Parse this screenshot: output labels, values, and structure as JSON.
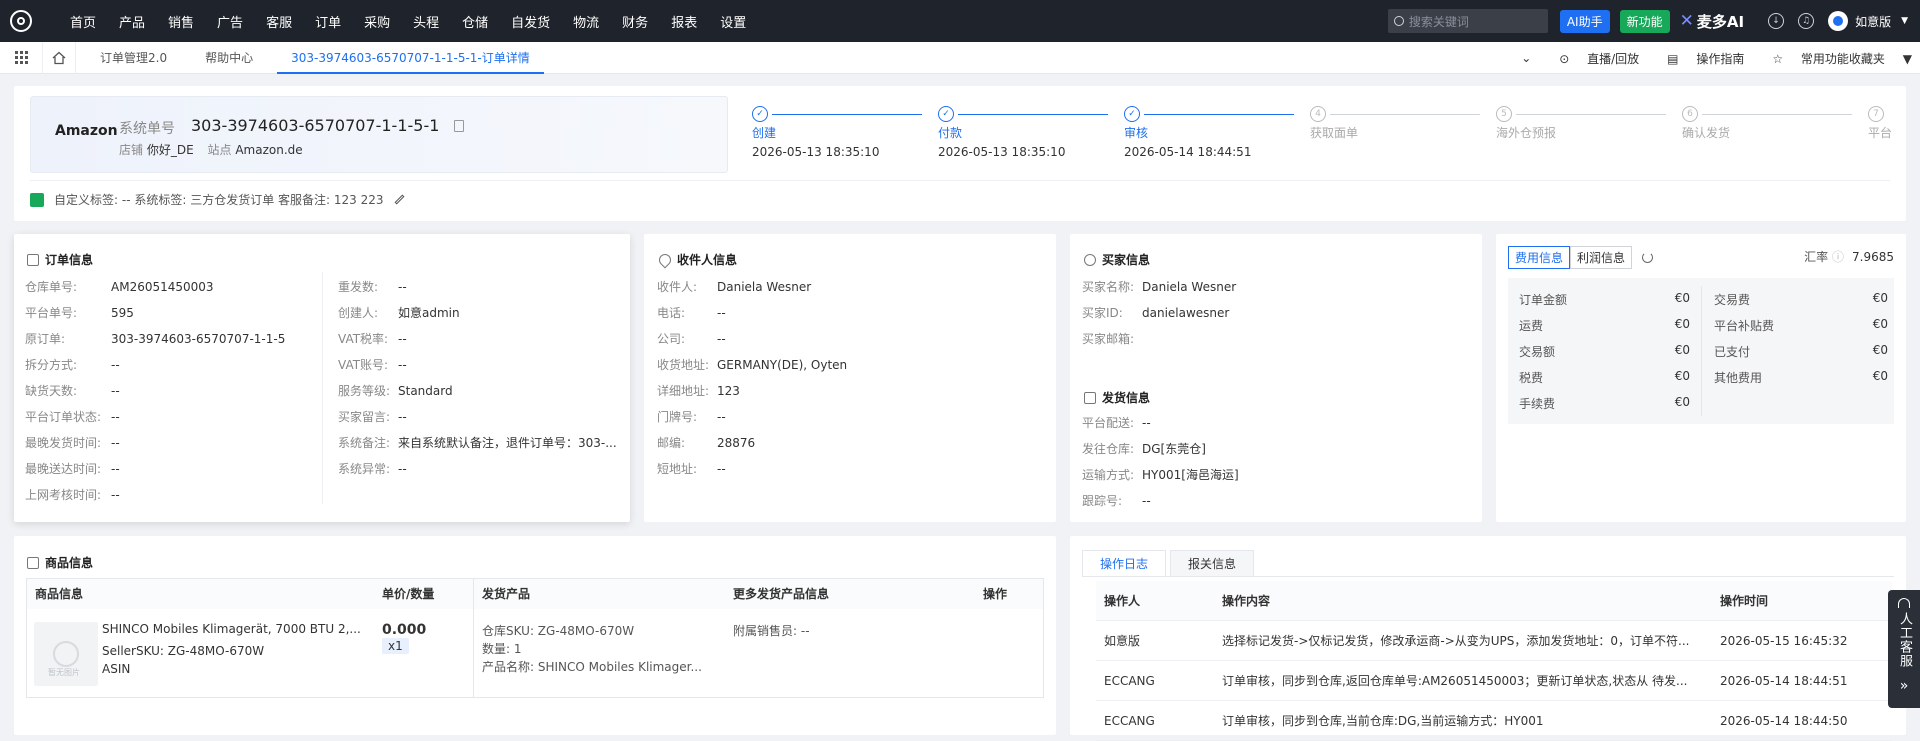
{
  "topbar": {
    "nav": [
      "首页",
      "产品",
      "销售",
      "广告",
      "客服",
      "订单",
      "采购",
      "头程",
      "仓储",
      "自发货",
      "物流",
      "财务",
      "报表",
      "设置"
    ],
    "search_placeholder": "搜索关键词",
    "ai_button": "AI助手",
    "new_button": "新功能",
    "brand": "麦多AI",
    "username": "如意版"
  },
  "tabbar": {
    "tabs": [
      "订单管理2.0",
      "帮助中心",
      "303-3974603-6570707-1-1-5-1-订单详情"
    ],
    "live": "直播/回放",
    "guide": "操作指南",
    "favorites": "常用功能收藏夹"
  },
  "order_header": {
    "platform": "Amazon",
    "sysno_label": "系统单号",
    "sysno": "303-3974603-6570707-1-1-5-1",
    "shop_label": "店铺",
    "shop": "你好_DE",
    "site_label": "站点",
    "site": "Amazon.de",
    "tags_line": "自定义标签: -- 系统标签: 三方仓发货订单 客服备注: 123 223"
  },
  "steps": [
    {
      "num": "✓",
      "label": "创建",
      "time": "2026-05-13 18:35:10",
      "done": true
    },
    {
      "num": "✓",
      "label": "付款",
      "time": "2026-05-13 18:35:10",
      "done": true
    },
    {
      "num": "✓",
      "label": "审核",
      "time": "2026-05-14 18:44:51",
      "done": true
    },
    {
      "num": "4",
      "label": "获取面单",
      "time": "",
      "done": false
    },
    {
      "num": "5",
      "label": "海外仓预报",
      "time": "",
      "done": false
    },
    {
      "num": "6",
      "label": "确认发货",
      "time": "",
      "done": false
    },
    {
      "num": "7",
      "label": "平台",
      "time": "",
      "done": false
    }
  ],
  "order_info": {
    "title": "订单信息",
    "left": [
      [
        "仓库单号:",
        "AM26051450003"
      ],
      [
        "平台单号:",
        "595"
      ],
      [
        "原订单:",
        "303-3974603-6570707-1-1-5"
      ],
      [
        "拆分方式:",
        "--"
      ],
      [
        "缺货天数:",
        "--"
      ],
      [
        "平台订单状态:",
        "--"
      ],
      [
        "最晚发货时间:",
        "--"
      ],
      [
        "最晚送达时间:",
        "--"
      ],
      [
        "上网考核时间:",
        "--"
      ]
    ],
    "right": [
      [
        "重发数:",
        "--"
      ],
      [
        "创建人:",
        "如意admin"
      ],
      [
        "VAT税率:",
        "--"
      ],
      [
        "VAT账号:",
        "--"
      ],
      [
        "服务等级:",
        "Standard"
      ],
      [
        "买家留言:",
        "--"
      ],
      [
        "系统备注:",
        "来自系统默认备注，退件订单号：303-..."
      ],
      [
        "系统异常:",
        "--"
      ]
    ]
  },
  "receiver": {
    "title": "收件人信息",
    "rows": [
      [
        "收件人:",
        "Daniela Wesner"
      ],
      [
        "电话:",
        "--"
      ],
      [
        "公司:",
        "--"
      ],
      [
        "收货地址:",
        "GERMANY(DE), Oyten"
      ],
      [
        "详细地址:",
        "123"
      ],
      [
        "门牌号:",
        "--"
      ],
      [
        "邮编:",
        "28876"
      ],
      [
        "短地址:",
        "--"
      ]
    ]
  },
  "buyer": {
    "title": "买家信息",
    "rows": [
      [
        "买家名称:",
        "Daniela Wesner"
      ],
      [
        "买家ID:",
        "danielawesner"
      ],
      [
        "买家邮箱:",
        ""
      ]
    ]
  },
  "shipping": {
    "title": "发货信息",
    "rows": [
      [
        "平台配送:",
        "--"
      ],
      [
        "发往仓库:",
        "DG[东莞仓]"
      ],
      [
        "运输方式:",
        "HY001[海邑海运]"
      ],
      [
        "跟踪号:",
        "--"
      ]
    ]
  },
  "fees": {
    "tab_fee": "费用信息",
    "tab_profit": "利润信息",
    "rate_label": "汇率",
    "rate": "7.9685",
    "left": [
      [
        "订单金额",
        "€0"
      ],
      [
        "运费",
        "€0"
      ],
      [
        "交易额",
        "€0"
      ],
      [
        "税费",
        "€0"
      ],
      [
        "手续费",
        "€0"
      ]
    ],
    "right": [
      [
        "交易费",
        "€0"
      ],
      [
        "平台补贴费",
        "€0"
      ],
      [
        "已支付",
        "€0"
      ],
      [
        "其他费用",
        "€0"
      ]
    ]
  },
  "goods": {
    "title": "商品信息",
    "headers": [
      "商品信息",
      "单价/数量",
      "发货产品",
      "更多发货产品信息",
      "操作"
    ],
    "name": "SHINCO Mobiles Klimagerät, 7000 BTU 2,...",
    "seller_sku": "SellerSKU:  ZG-48MO-670W",
    "asin": "ASIN",
    "price": "0.000",
    "qty": "x1",
    "wh_sku": "仓库SKU:  ZG-48MO-670W",
    "count": "数量:     1",
    "product_name": "产品名称:  SHINCO Mobiles Klimager...",
    "seller_label": "附属销售员: --",
    "img_label": "暂无图片"
  },
  "log": {
    "tab_log": "操作日志",
    "tab_customs": "报关信息",
    "headers": [
      "操作人",
      "操作内容",
      "操作时间"
    ],
    "rows": [
      [
        "如意版",
        "选择标记发货->仅标记发货，修改承运商->从变为UPS，添加发货地址：0，订单不符...",
        "2026-05-15 16:45:32"
      ],
      [
        "ECCANG",
        "订单审核，同步到仓库,返回仓库单号:AM26051450003；更新订单状态,状态从 待发...",
        "2026-05-14 18:44:51"
      ],
      [
        "ECCANG",
        "订单审核，同步到仓库,当前仓库:DG,当前运输方式：HY001",
        "2026-05-14 18:44:50"
      ]
    ]
  },
  "side": {
    "service": "人工客服"
  }
}
